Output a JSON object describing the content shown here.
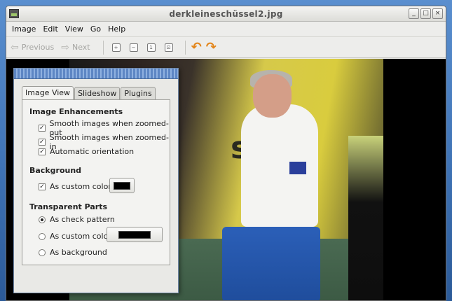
{
  "window": {
    "title": "derkleineschüssel2.jpg"
  },
  "menubar": {
    "items": [
      "Image",
      "Edit",
      "View",
      "Go",
      "Help"
    ]
  },
  "toolbar": {
    "previous": "Previous",
    "next": "Next"
  },
  "photo": {
    "banner_text": "sen"
  },
  "dialog": {
    "tabs": [
      "Image View",
      "Slideshow",
      "Plugins"
    ],
    "active_tab": "Image View",
    "enhancements": {
      "title": "Image Enhancements",
      "options": [
        {
          "label": "Smooth images when zoomed-out",
          "checked": true
        },
        {
          "label": "Smooth images when zoomed-in",
          "checked": true
        },
        {
          "label": "Automatic orientation",
          "checked": true
        }
      ]
    },
    "background": {
      "title": "Background",
      "custom_color_label": "As custom color:",
      "checked": true,
      "color": "#000000"
    },
    "transparent": {
      "title": "Transparent Parts",
      "options": [
        {
          "label": "As check pattern",
          "selected": true
        },
        {
          "label": "As custom color:",
          "selected": false
        },
        {
          "label": "As background",
          "selected": false
        }
      ],
      "color": "#000000"
    }
  },
  "colors": {
    "accent": "#5d86c4",
    "rotate": "#e3861c"
  }
}
